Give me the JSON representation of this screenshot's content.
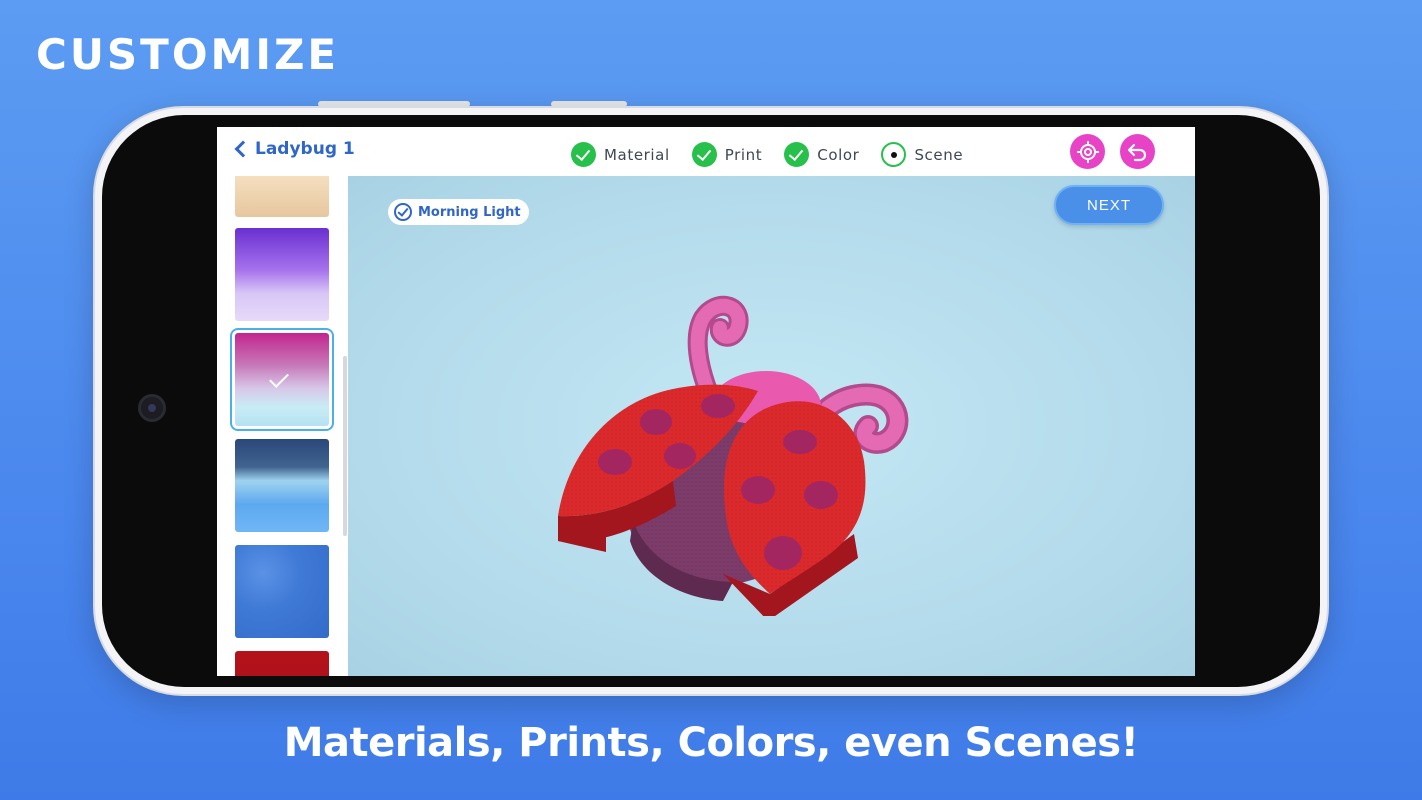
{
  "promo": {
    "headline": "CUSTOMIZE",
    "caption": "Materials, Prints, Colors, even Scenes!"
  },
  "topbar": {
    "back_title": "Ladybug 1",
    "steps": [
      {
        "label": "Material",
        "state": "done"
      },
      {
        "label": "Print",
        "state": "done"
      },
      {
        "label": "Color",
        "state": "done"
      },
      {
        "label": "Scene",
        "state": "current"
      }
    ],
    "icons": [
      "target-icon",
      "undo-icon"
    ]
  },
  "viewport": {
    "selected_scene": "Morning Light",
    "next_label": "NEXT"
  },
  "sidebar": {
    "scenes": [
      {
        "name": "peach-scene",
        "colors": [
          "#f7e6cc",
          "#e9cfa9"
        ]
      },
      {
        "name": "violet-scene",
        "colors": [
          "#7d3fd9",
          "#d9c8f6"
        ]
      },
      {
        "name": "morning-light-scene",
        "colors": [
          "#c62d9e",
          "#bfe9f6"
        ],
        "selected": true
      },
      {
        "name": "ice-scene",
        "colors": [
          "#2b4f86",
          "#7fc7f3"
        ]
      },
      {
        "name": "blue-texture-scene",
        "colors": [
          "#3f7ad6",
          "#3a6fcc"
        ]
      },
      {
        "name": "red-texture-scene",
        "colors": [
          "#b5121b",
          "#a00f17"
        ]
      }
    ]
  },
  "colors": {
    "accent_blue": "#2f66c7",
    "step_green": "#27c04a",
    "icon_pink": "#e843c7"
  }
}
